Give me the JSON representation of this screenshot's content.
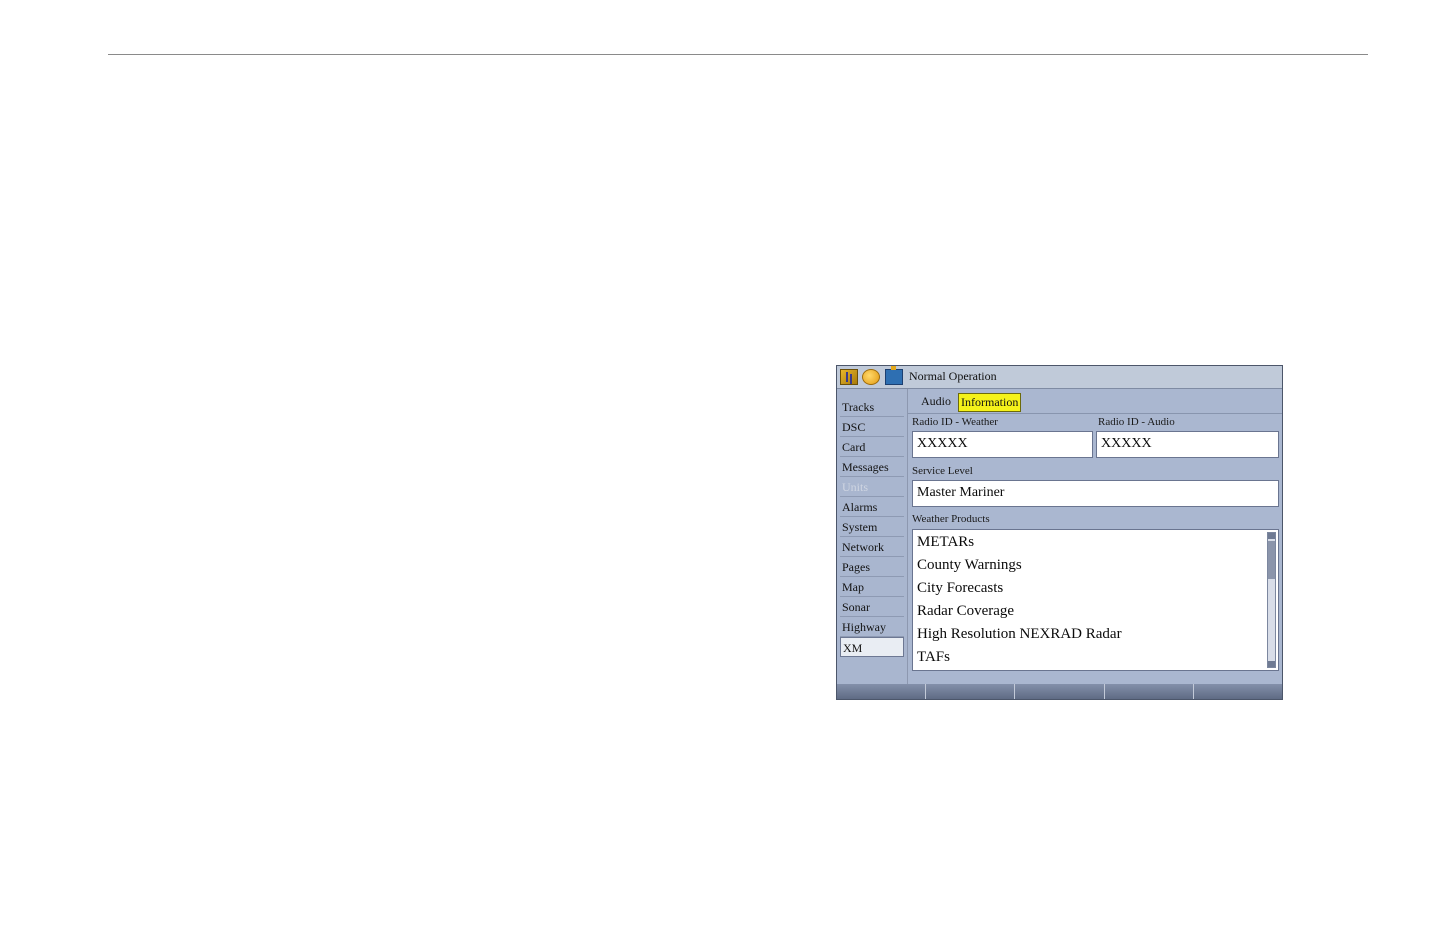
{
  "screen": {
    "title": "Normal Operation",
    "status_icons": [
      "gps-signal-icon",
      "sun-icon",
      "battery-icon"
    ]
  },
  "sidebar": {
    "items": [
      {
        "label": "Tracks",
        "state": "normal"
      },
      {
        "label": "DSC",
        "state": "normal"
      },
      {
        "label": "Card",
        "state": "normal"
      },
      {
        "label": "Messages",
        "state": "normal"
      },
      {
        "label": "Units",
        "state": "disabled"
      },
      {
        "label": "Alarms",
        "state": "normal"
      },
      {
        "label": "System",
        "state": "normal"
      },
      {
        "label": "Network",
        "state": "normal"
      },
      {
        "label": "Pages",
        "state": "normal"
      },
      {
        "label": "Map",
        "state": "normal"
      },
      {
        "label": "Sonar",
        "state": "normal"
      },
      {
        "label": "Highway",
        "state": "normal"
      },
      {
        "label": "XM",
        "state": "selected"
      }
    ]
  },
  "tabs": [
    {
      "label": "Audio",
      "active": false
    },
    {
      "label": "Information",
      "active": true
    }
  ],
  "fields": {
    "radio_id_weather": {
      "label": "Radio ID - Weather",
      "value": "XXXXX"
    },
    "radio_id_audio": {
      "label": "Radio ID - Audio",
      "value": "XXXXX"
    },
    "service_level": {
      "label": "Service Level",
      "value": "Master Mariner"
    }
  },
  "weather_products": {
    "label": "Weather Products",
    "items": [
      "METARs",
      "County Warnings",
      "City Forecasts",
      "Radar Coverage",
      "High Resolution NEXRAD Radar",
      "TAFs"
    ]
  },
  "colors": {
    "screen_bg": "#a9b6cf",
    "active_tab": "#f5f21a",
    "field_bg": "#ffffff"
  }
}
